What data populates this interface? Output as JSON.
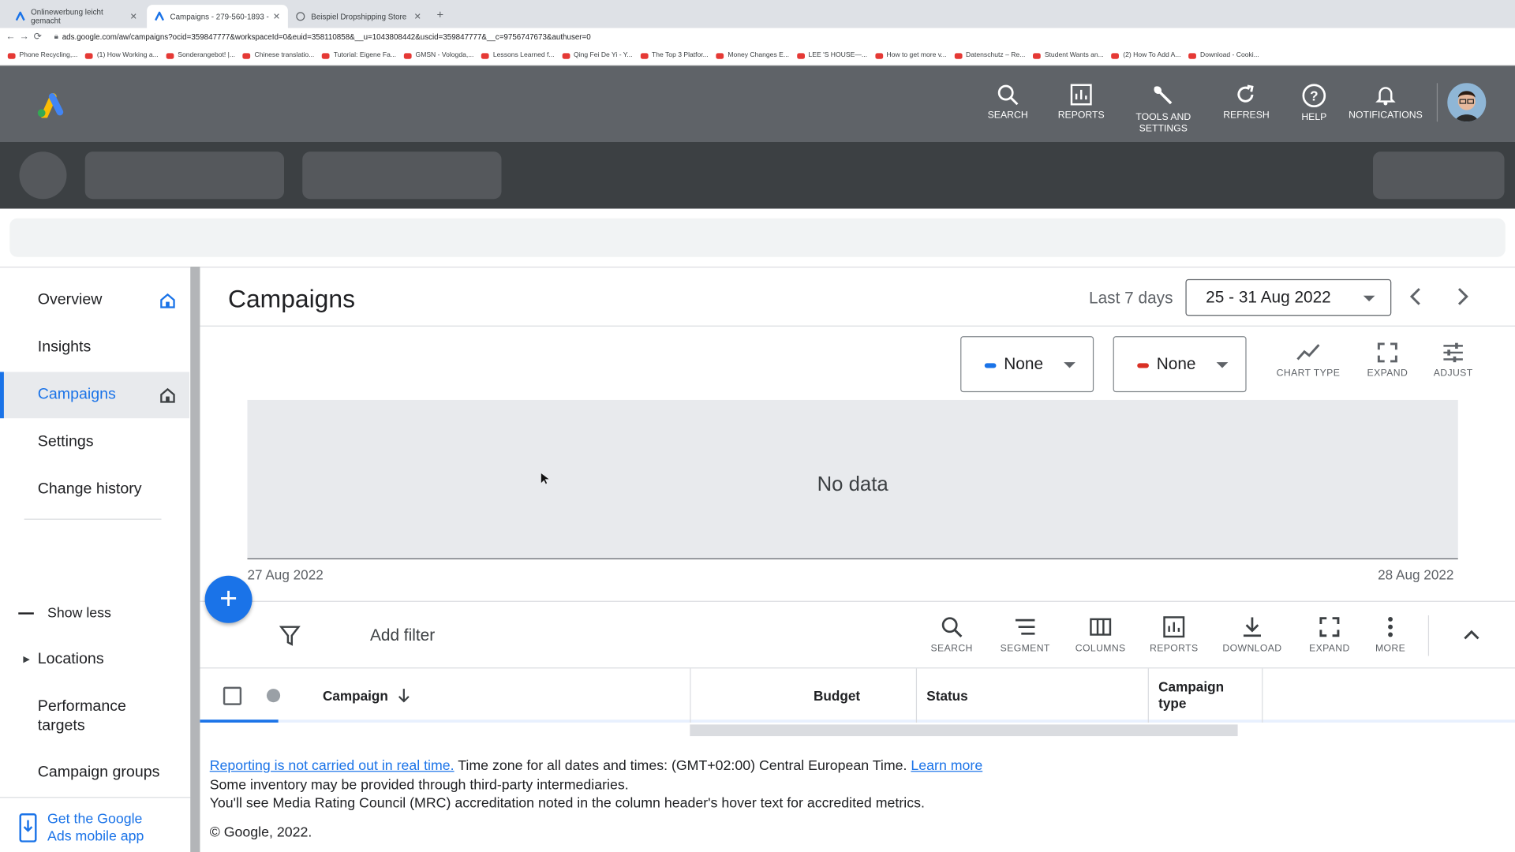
{
  "browser": {
    "tabs": [
      {
        "title": "Onlinewerbung leicht gemacht"
      },
      {
        "title": "Campaigns - 279-560-1893 -"
      },
      {
        "title": "Beispiel Dropshipping Store"
      }
    ],
    "url": "ads.google.com/aw/campaigns?ocid=359847777&workspaceId=0&euid=358110858&__u=1043808442&uscid=359847777&__c=9756747673&authuser=0",
    "bookmarks": [
      "Phone Recycling,...",
      "(1) How Working a...",
      "Sonderangebot! |...",
      "Chinese translatio...",
      "Tutorial: Eigene Fa...",
      "GMSN - Vologda,...",
      "Lessons Learned f...",
      "Qing Fei De Yi - Y...",
      "The Top 3 Platfor...",
      "Money Changes E...",
      "LEE 'S HOUSE—...",
      "How to get more v...",
      "Datenschutz – Re...",
      "Student Wants an...",
      "(2) How To Add A...",
      "Download - Cooki..."
    ]
  },
  "topbar": {
    "search": "SEARCH",
    "reports": "REPORTS",
    "tools_line1": "TOOLS AND",
    "tools_line2": "SETTINGS",
    "refresh": "REFRESH",
    "help": "HELP",
    "notifications": "NOTIFICATIONS"
  },
  "sidebar": {
    "items": [
      {
        "label": "Overview"
      },
      {
        "label": "Insights"
      },
      {
        "label": "Campaigns"
      },
      {
        "label": "Settings"
      },
      {
        "label": "Change history"
      }
    ],
    "show_less": "Show less",
    "locations": "Locations",
    "performance_targets_1": "Performance",
    "performance_targets_2": "targets",
    "campaign_groups": "Campaign groups",
    "mobile_app_1": "Get the Google",
    "mobile_app_2": "Ads mobile app"
  },
  "header": {
    "title": "Campaigns",
    "range_label": "Last 7 days",
    "date_range": "25 - 31 Aug 2022"
  },
  "chart_controls": {
    "metric1": "None",
    "metric2": "None",
    "metric1_color": "#1a73e8",
    "metric2_color": "#d93025",
    "chart_type": "CHART TYPE",
    "expand": "EXPAND",
    "adjust": "ADJUST"
  },
  "chart": {
    "empty_text": "No data",
    "x_start": "27 Aug 2022",
    "x_end": "28 Aug 2022"
  },
  "table_toolbar": {
    "add_filter": "Add filter",
    "search": "SEARCH",
    "segment": "SEGMENT",
    "columns": "COLUMNS",
    "reports": "REPORTS",
    "download": "DOWNLOAD",
    "expand": "EXPAND",
    "more": "MORE"
  },
  "table": {
    "columns": {
      "campaign": "Campaign",
      "budget": "Budget",
      "status": "Status",
      "campaign_type_1": "Campaign",
      "campaign_type_2": "type"
    }
  },
  "footer": {
    "reporting_link": "Reporting is not carried out in real time.",
    "timezone_text": " Time zone for all dates and times: (GMT+02:00) Central European Time. ",
    "learn_more": "Learn more",
    "inventory": "Some inventory may be provided through third-party intermediaries.",
    "mrc": "You'll see Media Rating Council (MRC) accreditation noted in the column header's hover text for accredited metrics.",
    "copyright": "© Google, 2022."
  }
}
